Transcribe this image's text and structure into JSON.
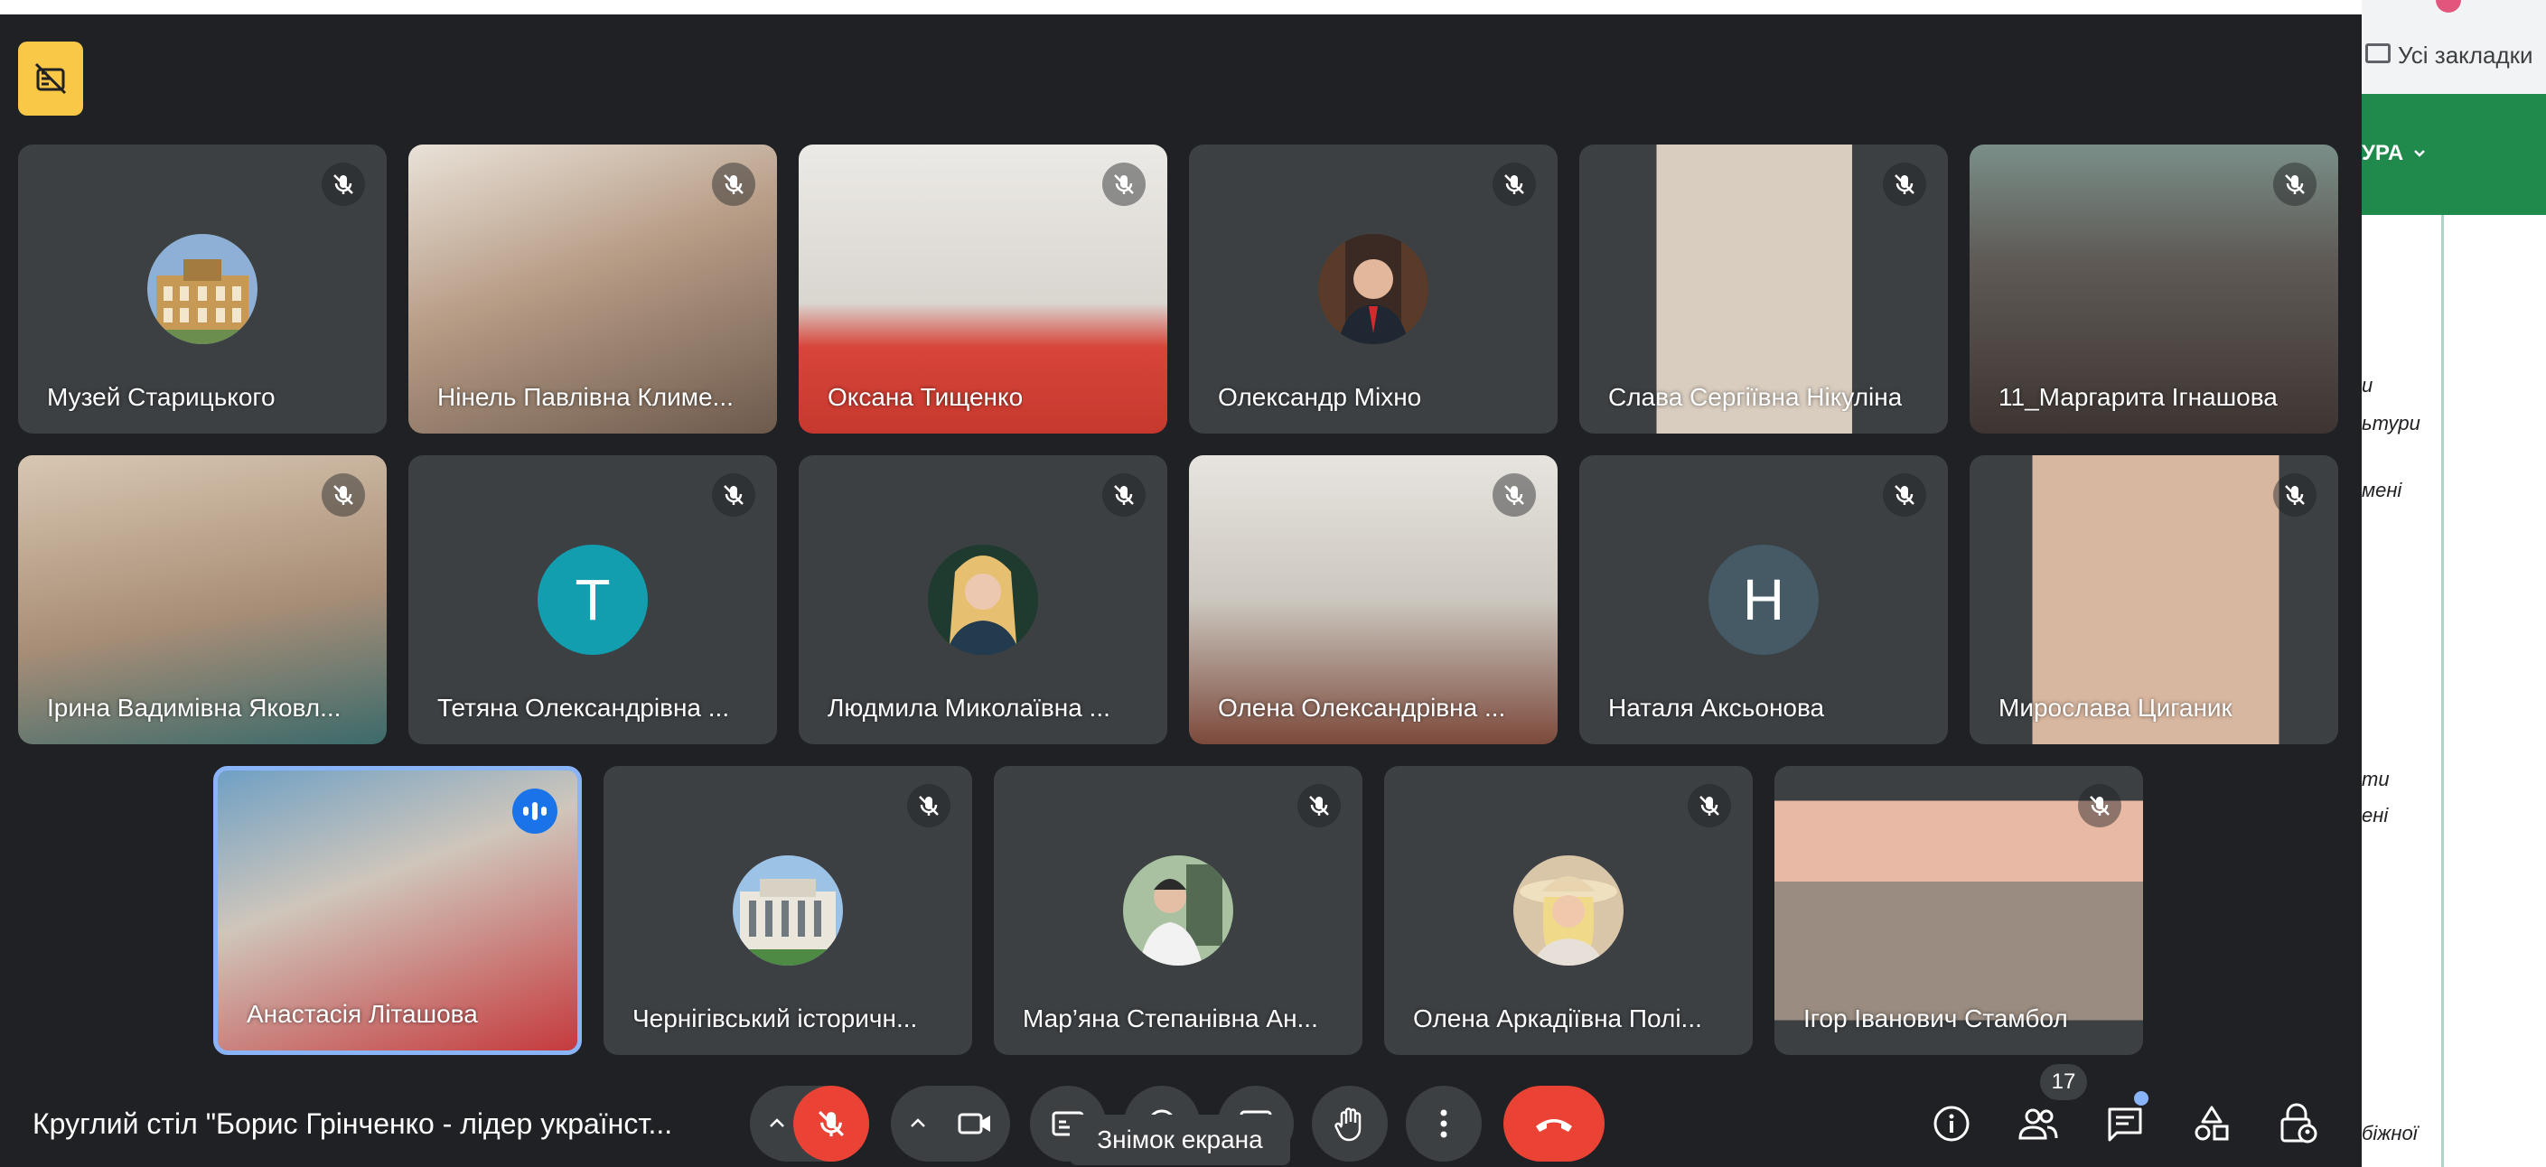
{
  "browser": {
    "bookmarks_label": "Усі закладки",
    "menu_label": "УРА",
    "side_fragments": [
      "и",
      "ьтури",
      "мені",
      "ти",
      "ені",
      "біжної"
    ]
  },
  "meeting": {
    "title": "Круглий стіл \"Борис Грінченко - лідер українст...",
    "participants_count": "17",
    "tooltip": "Знімок екрана"
  },
  "participants": [
    {
      "name": "Музей Старицького"
    },
    {
      "name": "Нінель Павлівна Климе..."
    },
    {
      "name": "Оксана Тищенко"
    },
    {
      "name": "Олександр Міхно"
    },
    {
      "name": "Слава Сергіївна Нікуліна"
    },
    {
      "name": "11_Маргарита Ігнашова"
    },
    {
      "name": "Ірина Вадимівна Яковл..."
    },
    {
      "name": "Тетяна Олександрівна ...",
      "initial": "Т"
    },
    {
      "name": "Людмила Миколаївна ..."
    },
    {
      "name": "Олена Олександрівна ..."
    },
    {
      "name": "Наталя Аксьонова",
      "initial": "Н"
    },
    {
      "name": "Мирослава Циганик"
    },
    {
      "name": "Анастасія Літашова"
    },
    {
      "name": "Чернігівський історичн..."
    },
    {
      "name": "Мар’яна Степанівна Ан..."
    },
    {
      "name": "Олена Аркадіївна Полі..."
    },
    {
      "name": "Ігор Іванович Стамбол"
    }
  ],
  "colors": {
    "background": "#202124",
    "tile": "#3c4043",
    "end_call": "#ea4335",
    "accent_blue": "#8ab4f8",
    "speaking": "#1a73e8",
    "banner": "#f9c846",
    "avatar_teal": "#129eaf",
    "avatar_slate": "#455a64"
  }
}
